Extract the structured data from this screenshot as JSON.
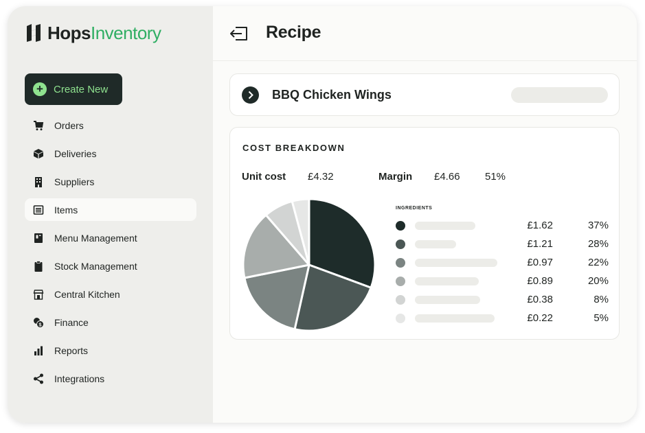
{
  "brand": {
    "name_part1": "Hops",
    "name_part2": "Inventory"
  },
  "create_button": {
    "label": "Create New"
  },
  "sidebar": {
    "items": [
      {
        "label": "Orders",
        "icon": "cart-icon"
      },
      {
        "label": "Deliveries",
        "icon": "box-icon"
      },
      {
        "label": "Suppliers",
        "icon": "building-icon"
      },
      {
        "label": "Items",
        "icon": "list-icon",
        "active": true
      },
      {
        "label": "Menu Management",
        "icon": "menu-book-icon"
      },
      {
        "label": "Stock Management",
        "icon": "clipboard-icon"
      },
      {
        "label": "Central Kitchen",
        "icon": "kitchen-icon"
      },
      {
        "label": "Finance",
        "icon": "coins-icon"
      },
      {
        "label": "Reports",
        "icon": "bar-chart-icon"
      },
      {
        "label": "Integrations",
        "icon": "share-icon"
      }
    ]
  },
  "header": {
    "title": "Recipe"
  },
  "recipe": {
    "name": "BBQ Chicken Wings"
  },
  "cost_breakdown": {
    "title": "COST BREAKDOWN",
    "unit_cost_label": "Unit cost",
    "unit_cost_value": "£4.32",
    "margin_label": "Margin",
    "margin_value": "£4.66",
    "margin_percent": "51%",
    "ingredients_heading": "INGREDIENTS",
    "ingredients": [
      {
        "amount": "£1.62",
        "percent": "37%",
        "color": "#1e2c2a"
      },
      {
        "amount": "£1.21",
        "percent": "28%",
        "color": "#4b5755"
      },
      {
        "amount": "£0.97",
        "percent": "22%",
        "color": "#7b8482"
      },
      {
        "amount": "£0.89",
        "percent": "20%",
        "color": "#a8adab"
      },
      {
        "amount": "£0.38",
        "percent": "8%",
        "color": "#d2d4d3"
      },
      {
        "amount": "£0.22",
        "percent": "5%",
        "color": "#e6e7e6"
      }
    ]
  },
  "chart_data": {
    "type": "pie",
    "values": [
      1.62,
      1.21,
      0.97,
      0.89,
      0.38,
      0.22
    ],
    "colors": [
      "#1e2c2a",
      "#4b5755",
      "#7b8482",
      "#a8adab",
      "#d2d4d3",
      "#e6e7e6"
    ]
  }
}
